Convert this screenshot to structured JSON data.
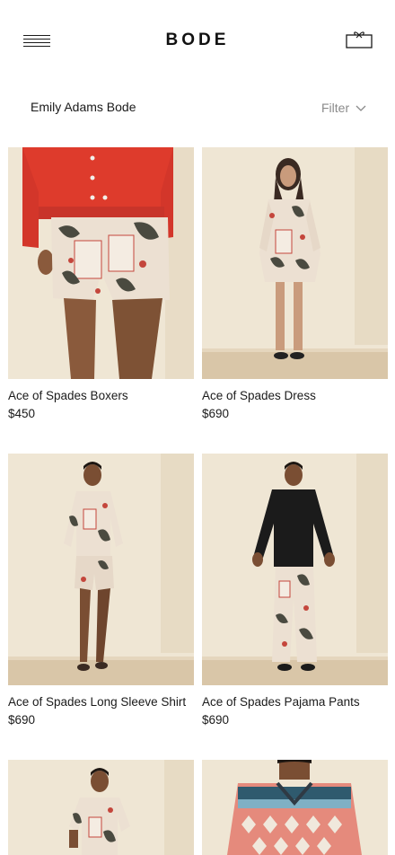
{
  "header": {
    "logo": "BODE",
    "menu_icon": "hamburger-menu-icon",
    "cart_icon": "shopping-bag-icon"
  },
  "filter_bar": {
    "brand": "Emily Adams Bode",
    "filter_label": "Filter",
    "filter_icon": "chevron-down-icon"
  },
  "products": [
    {
      "name": "Ace of Spades Boxers",
      "price": "$450"
    },
    {
      "name": "Ace of Spades Dress",
      "price": "$690"
    },
    {
      "name": "Ace of Spades Long Sleeve Shirt",
      "price": "$690"
    },
    {
      "name": "Ace of Spades Pajama Pants",
      "price": "$690"
    },
    {
      "name": "",
      "price": ""
    },
    {
      "name": "",
      "price": ""
    }
  ],
  "colors": {
    "wall": "#eee5d2",
    "floor": "#d9c6a8",
    "print_base": "#ece0d2",
    "print_red": "#c4463c",
    "print_dark": "#4a4a40",
    "sweater_red": "#de3b2c"
  }
}
